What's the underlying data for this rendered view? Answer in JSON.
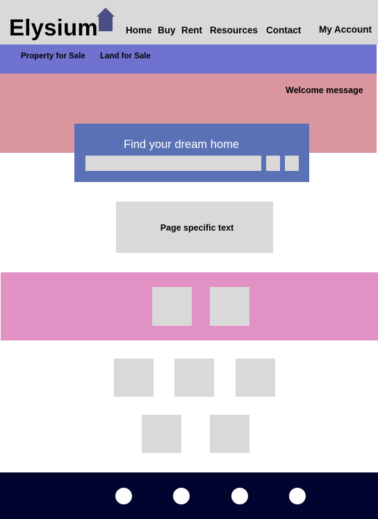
{
  "header": {
    "logo_text": "Elysium",
    "logo_icon": "house-icon",
    "nav": [
      "Home",
      "Buy",
      "Rent",
      "Resources",
      "Contact"
    ],
    "account_label": "My Account"
  },
  "subnav": {
    "items": [
      "Property for Sale",
      "Land for Sale"
    ]
  },
  "hero": {
    "welcome": "Welcome message",
    "search_title": "Find your dream home",
    "search_placeholder": ""
  },
  "content": {
    "page_text": "Page specific text"
  },
  "footer": {
    "social_icons": [
      "social-icon-1",
      "social-icon-2",
      "social-icon-3",
      "social-icon-4"
    ]
  },
  "colors": {
    "header_bg": "#d9d9d9",
    "subnav_bg": "#6f73cf",
    "hero_bg": "#d9969f",
    "search_card_bg": "#5a72b5",
    "band_bg": "#e191c3",
    "footer_bg": "#00042e",
    "logo_house": "#4a4e83"
  }
}
